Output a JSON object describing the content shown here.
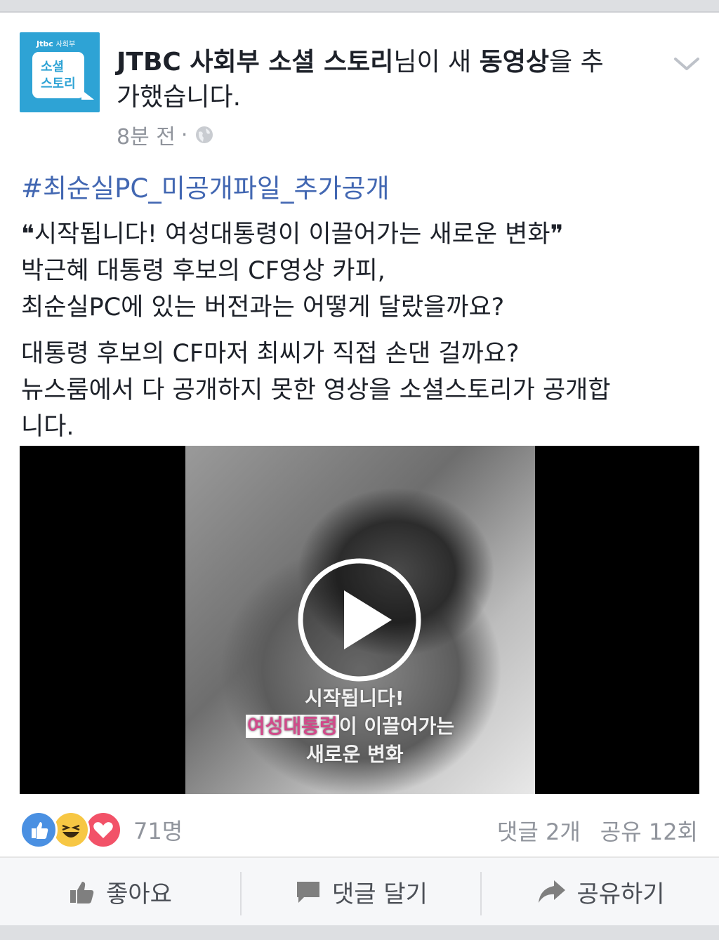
{
  "post": {
    "page_name": "JTBC 사회부 소셜 스토리",
    "title_mid": "님이 새 ",
    "title_bold2": "동영상",
    "title_end_line1": "을 추",
    "title_line2": "가했습니다.",
    "time": "8분 전",
    "meta_sep": "·",
    "privacy_icon": "globe-icon",
    "menu_icon": "chevron-down-icon"
  },
  "avatar": {
    "brand": "Jtbc",
    "brand_sub": "사회부",
    "logo_line1": "소셜",
    "logo_line2": "스토리",
    "bg_color": "#2ea3d5"
  },
  "content": {
    "hashtag": "#최순실PC_미공개파일_추가공개",
    "paragraph1": [
      "❝시작됩니다! 여성대통령이 이끌어가는 새로운 변화❞",
      "박근혜 대통령 후보의 CF영상 카피,",
      "최순실PC에 있는 버전과는 어떻게 달랐을까요?"
    ],
    "paragraph2": [
      "대통령 후보의 CF마저 최씨가 직접 손댄 걸까요?",
      "뉴스룸에서 다 공개하지 못한 영상을 소셜스토리가 공개합",
      "니다."
    ]
  },
  "video": {
    "caption1": "시작됩니다!",
    "caption2_highlight": "여성대통령",
    "caption2_rest": "이 이끌어가는",
    "caption3": "새로운 변화",
    "play_icon": "play-icon"
  },
  "engagement": {
    "reactions": [
      "like-react-icon",
      "haha-react-icon",
      "love-react-icon"
    ],
    "reaction_count": "71명",
    "comments": "댓글 2개",
    "shares": "공유 12회"
  },
  "actions": {
    "like": "좋아요",
    "comment": "댓글 달기",
    "share": "공유하기"
  },
  "colors": {
    "link": "#4267b2",
    "muted": "#90949c",
    "text": "#1d2129"
  }
}
